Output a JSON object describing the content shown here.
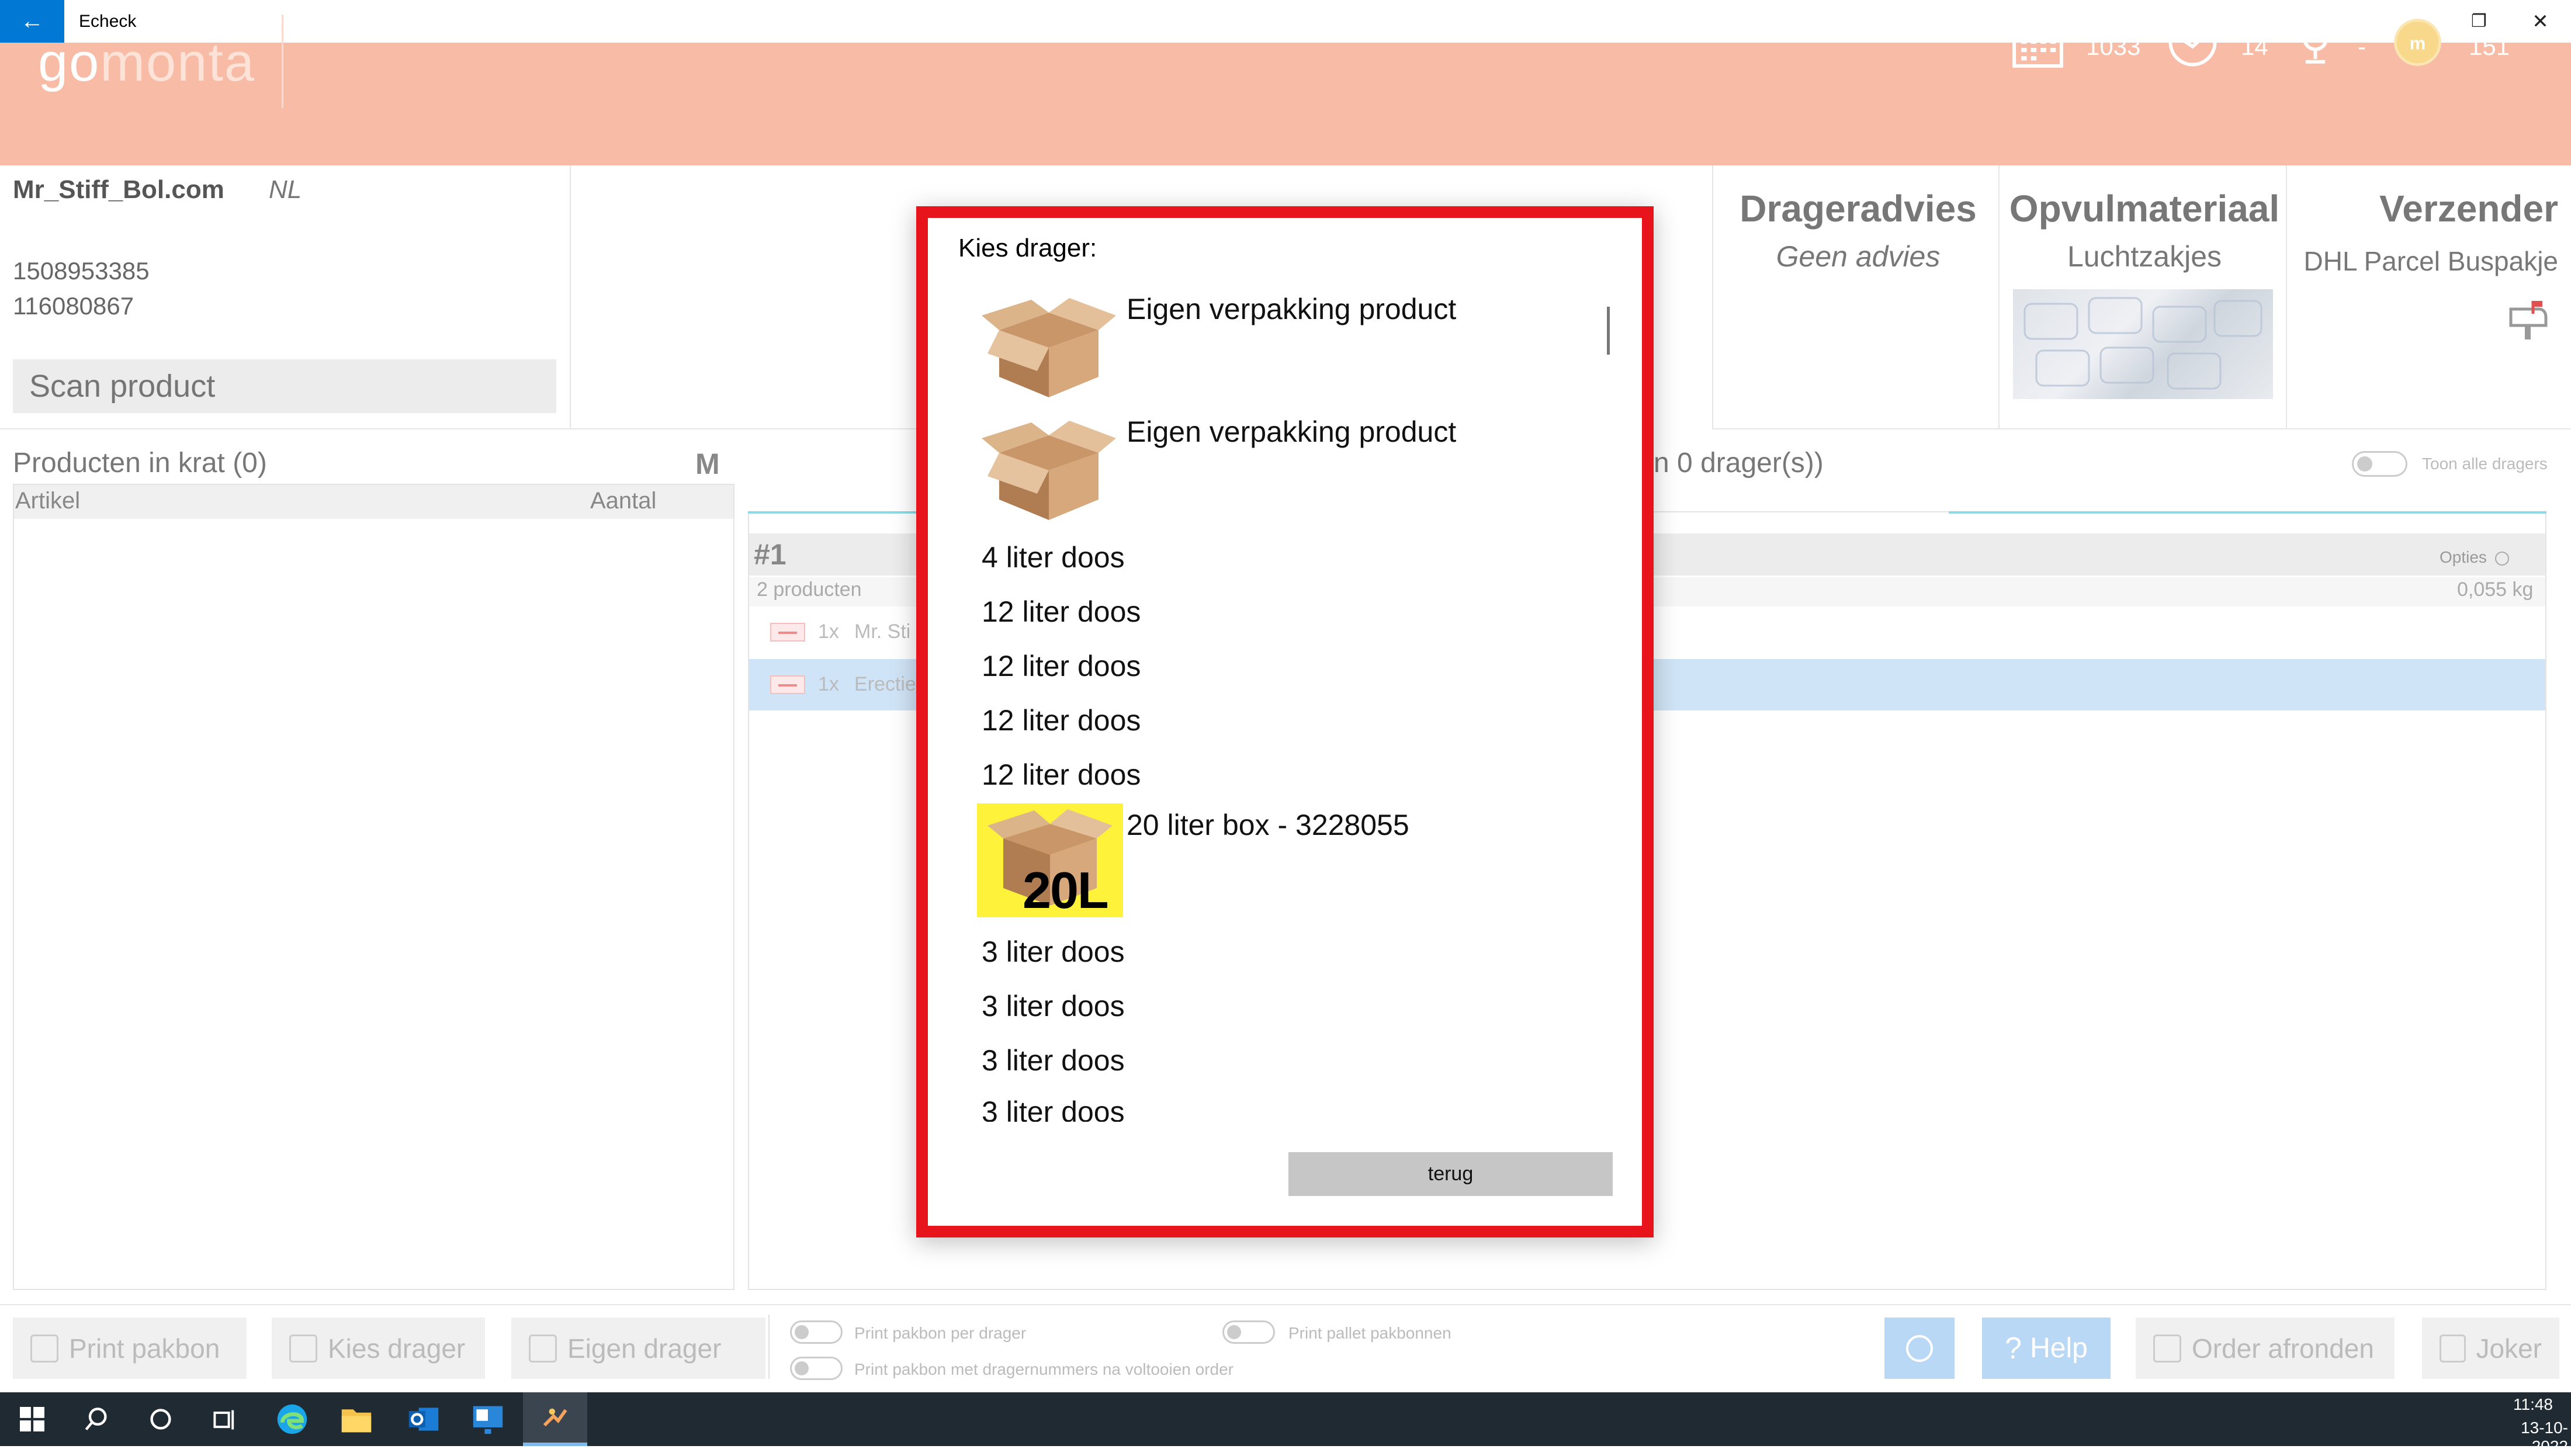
{
  "window": {
    "title": "Echeck",
    "back_glyph": "←",
    "minimize_glyph": "–",
    "restore_glyph": "❐",
    "close_glyph": "✕"
  },
  "header": {
    "logo_part1": "go",
    "logo_part2": "monta",
    "stats": [
      {
        "icon": "calendar-icon",
        "value": "1033"
      },
      {
        "icon": "clock-icon",
        "value": "14"
      },
      {
        "icon": "trophy-icon",
        "value": "-"
      },
      {
        "icon": "coin-icon",
        "value": "151"
      }
    ]
  },
  "order": {
    "name": "Mr_Stiff_Bol.com",
    "country": "NL",
    "number_1": "1508953385",
    "number_2": "116080867",
    "scan_placeholder": "Scan product"
  },
  "advice": {
    "drageradvies_title": "Drageradvies",
    "drageradvies_value": "Geen advies",
    "opvul_title": "Opvulmateriaal",
    "opvul_value": "Luchtzakjes",
    "verzender_title": "Verzender",
    "verzender_value": "DHL Parcel Buspakje"
  },
  "products_panel": {
    "title": "Producten in krat (0)",
    "marker": "M",
    "col_article": "Artikel",
    "col_qty": "Aantal"
  },
  "carriers_panel": {
    "title_partial": "n 0 drager(s))",
    "toggle_label": "Toon alle dragers",
    "drager_number": "#1",
    "options_label": "Opties",
    "product_count": "2 producten",
    "weight": "0,055 kg",
    "lines": [
      {
        "qty": "1x",
        "name": "Mr. Sti"
      },
      {
        "qty": "1x",
        "name": "Erectie"
      }
    ]
  },
  "bottom_bar": {
    "print_pakbon": "Print pakbon",
    "kies_drager": "Kies drager",
    "eigen_drager": "Eigen drager",
    "toggle_per_drager": "Print pakbon per drager",
    "toggle_dragernummers": "Print pakbon met dragernummers na voltooien order",
    "toggle_pallet": "Print pallet pakbonnen",
    "help": "Help",
    "order_afronden": "Order afronden",
    "joker": "Joker"
  },
  "taskbar": {
    "time": "11:48",
    "date": "13-10-2022"
  },
  "modal": {
    "title": "Kies drager:",
    "options": [
      {
        "label": "Eigen verpakking product",
        "icon": "box-icon"
      },
      {
        "label": "Eigen verpakking product",
        "icon": "box-icon"
      },
      {
        "label": "4 liter doos"
      },
      {
        "label": "12 liter doos"
      },
      {
        "label": "12 liter doos"
      },
      {
        "label": "12 liter doos"
      },
      {
        "label": "12 liter doos"
      },
      {
        "label": "20 liter box - 3228055",
        "icon": "box-20l-icon",
        "badge": "20L"
      },
      {
        "label": "3 liter doos"
      },
      {
        "label": "3 liter doos"
      },
      {
        "label": "3 liter doos"
      },
      {
        "label": "3 liter doos"
      }
    ],
    "back_button": "terug"
  },
  "colors": {
    "header_bg": "#f8bca6",
    "accent_blue": "#0078d4",
    "modal_border": "#e8141b",
    "box_highlight": "#fff23a"
  }
}
